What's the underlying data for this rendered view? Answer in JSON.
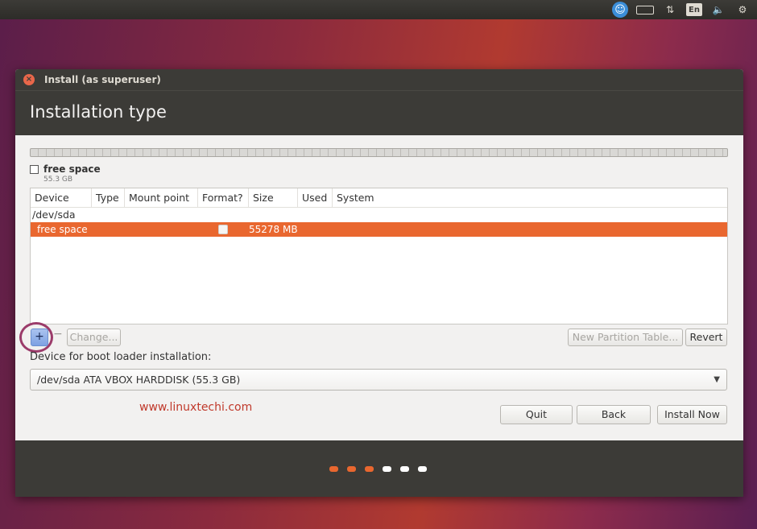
{
  "panel": {
    "language": "En",
    "colors": {
      "background": "#3c3b37",
      "icon": "#dfdbd2",
      "accessibility": "#3b8ed8"
    }
  },
  "window": {
    "title": "Install (as superuser)",
    "header": "Installation type"
  },
  "partition_bar": {
    "legend_label": "free space",
    "legend_size": "55.3 GB"
  },
  "table": {
    "columns": [
      "Device",
      "Type",
      "Mount point",
      "Format?",
      "Size",
      "Used",
      "System"
    ],
    "device_row": "/dev/sda",
    "selected_row": {
      "device": "free space",
      "format_checked": false,
      "size": "55278 MB"
    }
  },
  "buttons": {
    "add": "+",
    "remove": "−",
    "change": "Change...",
    "new_partition_table": "New Partition Table...",
    "revert": "Revert",
    "quit": "Quit",
    "back": "Back",
    "install_now": "Install Now"
  },
  "boot_loader": {
    "label": "Device for boot loader installation:",
    "selected": "/dev/sda ATA VBOX HARDDISK (55.3 GB)"
  },
  "watermark": "www.linuxtechi.com",
  "progress": {
    "steps_total": 6,
    "steps_done": 3,
    "active_color": "#e9672f",
    "inactive_color": "#ffffff"
  },
  "colors": {
    "accent": "#e9672f",
    "window_dark": "#3c3b37",
    "window_light": "#f2f1f0"
  }
}
